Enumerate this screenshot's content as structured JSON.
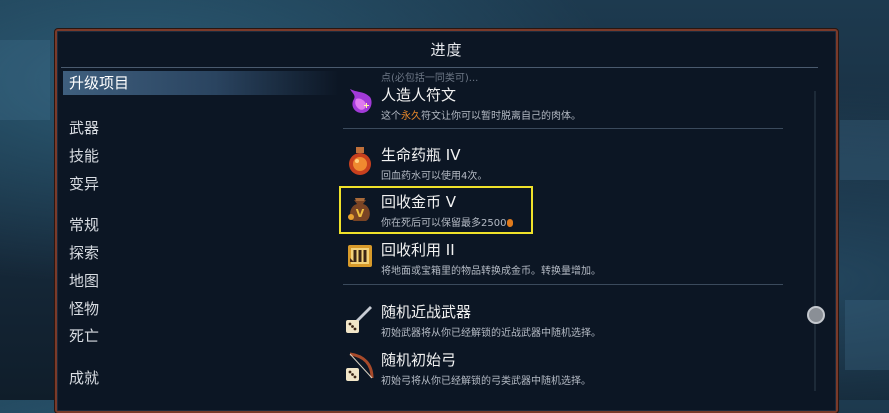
{
  "panel": {
    "title": "进度"
  },
  "sidebar": {
    "items": [
      {
        "label": "升级项目",
        "active": true
      },
      {
        "label": "武器"
      },
      {
        "label": "技能"
      },
      {
        "label": "变异"
      },
      {
        "label": "常规"
      },
      {
        "label": "探索"
      },
      {
        "label": "地图"
      },
      {
        "label": "怪物"
      },
      {
        "label": "死亡"
      },
      {
        "label": "成就"
      }
    ]
  },
  "list": {
    "faded_top": "点(必包括一同类可)...",
    "entries": [
      {
        "name": "人造人符文",
        "desc_before": "这个",
        "desc_highlight": "永久",
        "desc_after": "符文让你可以暂时脱离自己的肉体。",
        "icon": "purple-flame-rune-icon"
      },
      {
        "name": "生命药瓶 IV",
        "desc": "回血药水可以使用4次。",
        "icon": "health-flask-icon"
      },
      {
        "name": "回收金币 V",
        "desc": "你在死后可以保留最多2500",
        "icon": "gold-sack-icon",
        "selected": true
      },
      {
        "name": "回收利用 II",
        "desc": "将地面或宝箱里的物品转换成金币。转换量增加。",
        "icon": "recycle-scroll-icon"
      },
      {
        "name": "随机近战武器",
        "desc": "初始武器将从你已经解锁的近战武器中随机选择。",
        "icon": "random-sword-dice-icon"
      },
      {
        "name": "随机初始弓",
        "desc": "初始弓将从你已经解锁的弓类武器中随机选择。",
        "icon": "random-bow-dice-icon"
      }
    ]
  },
  "colors": {
    "highlight_border": "#f0e22a",
    "accent_orange": "#e8882a",
    "panel_border": "#7a3a2a"
  }
}
